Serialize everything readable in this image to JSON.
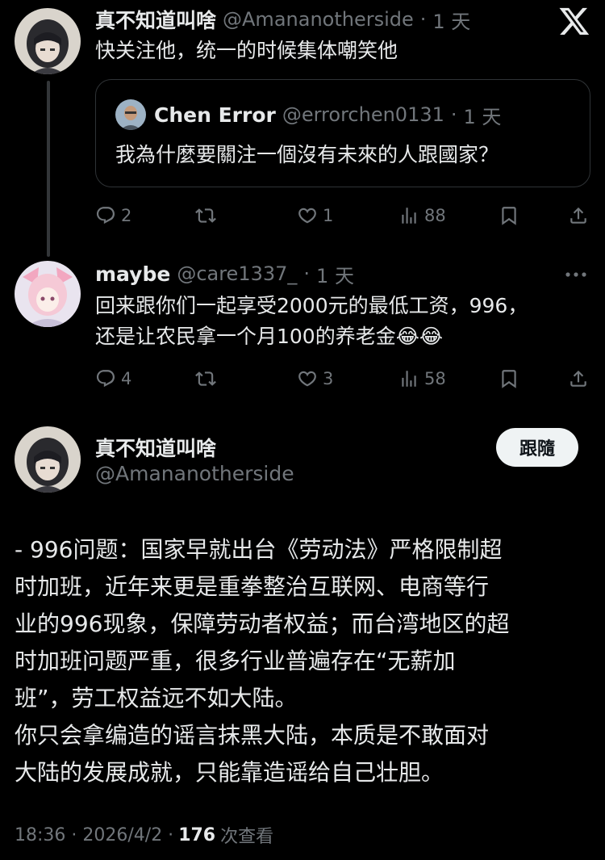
{
  "reply1": {
    "name": "真不知道叫啥",
    "handle": "@Amananotherside",
    "sep": "·",
    "time": "1 天",
    "text": "快关注他，统一的时候集体嘲笑他",
    "quote": {
      "name": "Chen Error",
      "handle": "@errorchen0131",
      "sep": "·",
      "time": "1 天",
      "text": "我為什麼要關注一個沒有未來的人跟國家？"
    },
    "stats": {
      "replies": "2",
      "likes": "1",
      "views": "88"
    }
  },
  "reply2": {
    "name": "maybe",
    "handle": "@care1337_",
    "sep": "·",
    "time": "1 天",
    "line1": "回来跟你们一起享受2000元的最低工资，996，",
    "line2": "还是让农民拿一个月100的养老金😂😂",
    "stats": {
      "replies": "4",
      "retweets": "3",
      "views": "58"
    }
  },
  "main": {
    "name": "真不知道叫啥",
    "handle": "@Amananotherside",
    "follow_label": "跟隨",
    "para1": "- 996问题：国家早就出台《劳动法》严格限制超\n时加班，近年来更是重拳整治互联网、电商等行\n业的996现象，保障劳动者权益；而台湾地区的超\n时加班问题严重，很多行业普遍存在“无薪加\n班”，劳工权益远不如大陆。",
    "para2": "你只会拿编造的谣言抹黑大陆，本质是不敢面对\n大陆的发展成就，只能靠造谣给自己壮胆。",
    "footer_time": "18:36 · 2026/4/2 ·",
    "footer_views": "176",
    "footer_views_label": "次查看"
  },
  "colors": {
    "bg": "#000000",
    "text": "#e7e9ea",
    "muted": "#71767b",
    "border": "#2f3336"
  }
}
